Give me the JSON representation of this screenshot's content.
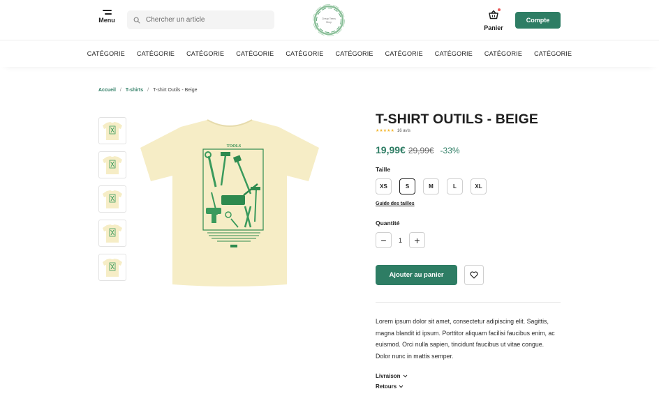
{
  "header": {
    "menu_label": "Menu",
    "search_placeholder": "Chercher un article",
    "logo_text": "Cheap Teens Shop",
    "cart_label": "Panier",
    "account_label": "Compte"
  },
  "categories": [
    "CATÉGORIE",
    "CATÉGORIE",
    "CATÉGORIE",
    "CATÉGORIE",
    "CATÉGORIE",
    "CATÉGORIE",
    "CATÉGORIE",
    "CATÉGORIE",
    "CATÉGORIE",
    "CATÉGORIE"
  ],
  "breadcrumb": {
    "home": "Accueil",
    "category": "T-shirts",
    "current": "T-shirt Outils - Beige",
    "separator": "/"
  },
  "product": {
    "title": "T-SHIRT OUTILS - BEIGE",
    "rating_stars": "★★★★★",
    "rating_value": 5,
    "reviews": "16 avis",
    "price_now": "19,99€",
    "price_old": "29,99€",
    "discount": "-33%",
    "size_label": "Taille",
    "sizes": [
      "XS",
      "S",
      "M",
      "L",
      "XL"
    ],
    "selected_size": "S",
    "size_guide": "Guide des tailles",
    "quantity_label": "Quantité",
    "quantity": "1",
    "minus": "−",
    "plus": "+",
    "add_to_cart": "Ajouter au panier",
    "description": "Lorem ipsum dolor sit amet, consectetur adipiscing elit. Sagittis, magna blandit id ipsum. Porttitor aliquam facilisi faucibus enim, ac euismod. Orci nulla sapien, tincidunt faucibus ut vitae congue. Dolor nunc in mattis semper.",
    "shipping_label": "Livraison",
    "returns_label": "Retours",
    "print_title": "TOOLS",
    "thumbnail_count": 5
  },
  "colors": {
    "brand": "#2e7d64",
    "shirt": "#f6edc6",
    "star": "#f3b731",
    "badge": "#e85a5a"
  }
}
